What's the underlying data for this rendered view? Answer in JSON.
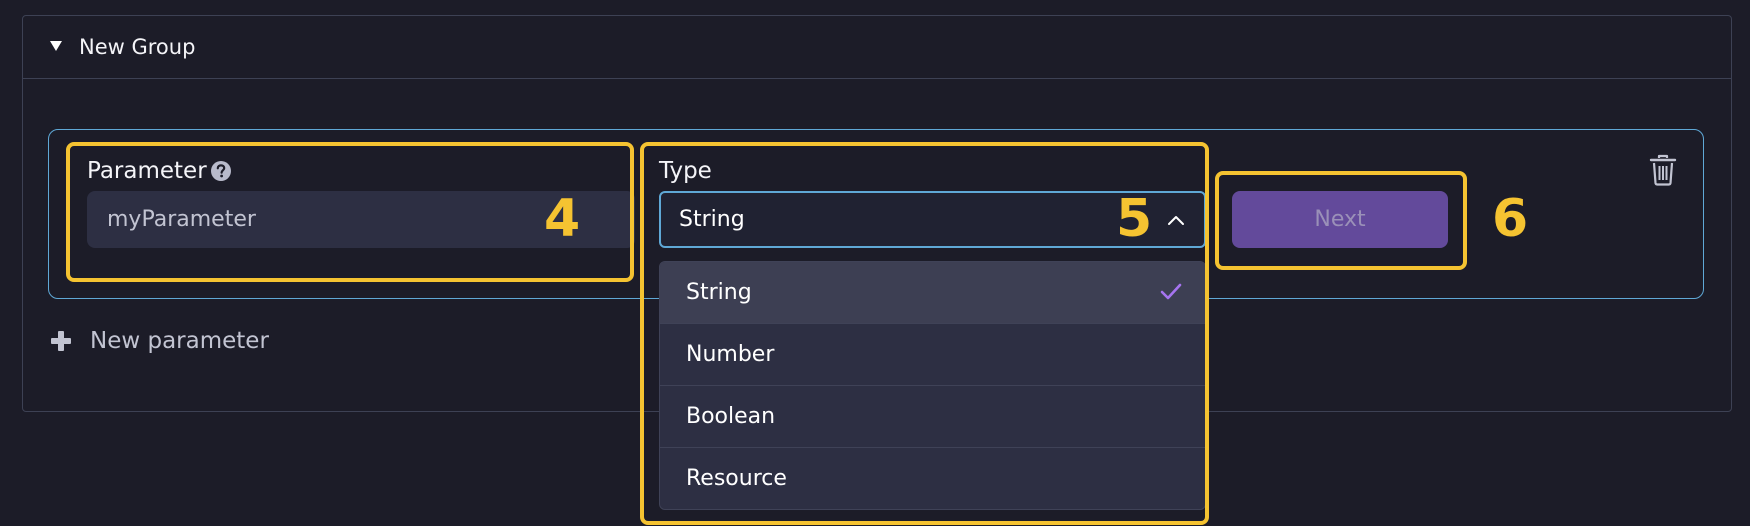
{
  "group": {
    "title": "New Group",
    "collapse_icon": "caret-down-icon"
  },
  "parameter": {
    "label": "Parameter",
    "help_icon": "question-circle-icon",
    "value": "myParameter"
  },
  "type_field": {
    "label": "Type",
    "selected_value": "String",
    "toggle_icon": "chevron-up-icon",
    "options": [
      {
        "label": "String",
        "selected": true
      },
      {
        "label": "Number",
        "selected": false
      },
      {
        "label": "Boolean",
        "selected": false
      },
      {
        "label": "Resource",
        "selected": false
      }
    ],
    "selected_icon": "checkmark-icon"
  },
  "next_button": {
    "label": "Next",
    "disabled": true
  },
  "delete_icon": "trash-icon",
  "add_parameter": {
    "label": "New parameter",
    "icon": "plus-icon"
  },
  "callouts": [
    "4",
    "5",
    "6"
  ],
  "colors": {
    "background": "#1c1c28",
    "accent_blue": "#5fa8d6",
    "callout_yellow": "#f5c331",
    "button_purple": "#634a9b",
    "check_purple": "#a674f0"
  }
}
